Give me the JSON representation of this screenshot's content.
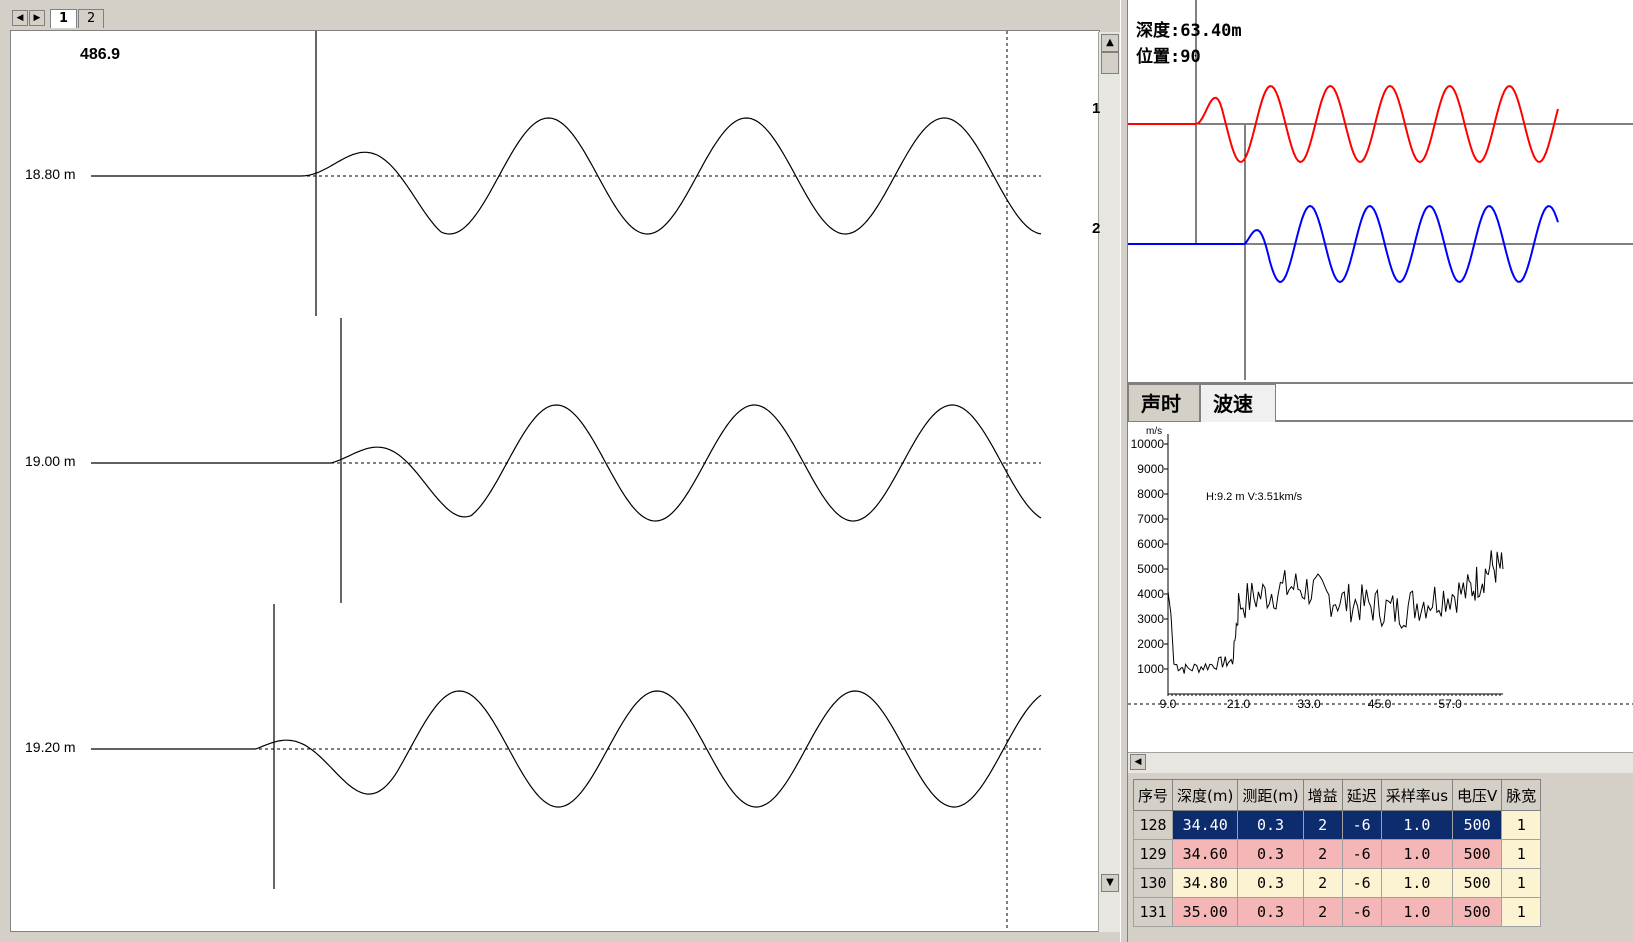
{
  "left": {
    "tabs": [
      "1",
      "2"
    ],
    "active_tab": "1",
    "top_value": "486.9",
    "traces": [
      {
        "depth_label": "18.80 m"
      },
      {
        "depth_label": "19.00 m"
      },
      {
        "depth_label": "19.20 m"
      }
    ]
  },
  "wave": {
    "depth": "深度:63.40m",
    "position": "位置:90",
    "channels": [
      {
        "label": "1",
        "color": "#ff0000"
      },
      {
        "label": "2",
        "color": "#0000ff"
      }
    ]
  },
  "velocity": {
    "tabs": [
      "声时",
      "波速"
    ],
    "active_tab": "波速",
    "unit": "m/s",
    "readout": "H:9.2 m V:3.51km/s"
  },
  "chart_data": {
    "type": "line",
    "ylim": [
      0,
      10000
    ],
    "y_ticks": [
      "10000",
      "9000",
      "8000",
      "7000",
      "6000",
      "5000",
      "4000",
      "3000",
      "2000",
      "1000"
    ],
    "x_ticks": [
      "9.0",
      "21.0",
      "33.0",
      "45.0",
      "57.0"
    ],
    "xlim": [
      9.0,
      66.0
    ],
    "series_color": "#000000",
    "trend": [
      {
        "x": 9.0,
        "y": 4100
      },
      {
        "x": 9.5,
        "y": 3200
      },
      {
        "x": 10.0,
        "y": 1200
      },
      {
        "x": 12.0,
        "y": 1000
      },
      {
        "x": 15.0,
        "y": 1100
      },
      {
        "x": 18.0,
        "y": 1250
      },
      {
        "x": 20.0,
        "y": 1300
      },
      {
        "x": 21.0,
        "y": 3600
      },
      {
        "x": 24.0,
        "y": 3900
      },
      {
        "x": 27.0,
        "y": 4100
      },
      {
        "x": 30.0,
        "y": 4300
      },
      {
        "x": 33.0,
        "y": 4200
      },
      {
        "x": 36.0,
        "y": 3900
      },
      {
        "x": 39.0,
        "y": 3700
      },
      {
        "x": 42.0,
        "y": 3600
      },
      {
        "x": 45.0,
        "y": 3500
      },
      {
        "x": 48.0,
        "y": 3300
      },
      {
        "x": 51.0,
        "y": 3600
      },
      {
        "x": 54.0,
        "y": 3800
      },
      {
        "x": 57.0,
        "y": 4000
      },
      {
        "x": 60.0,
        "y": 4100
      },
      {
        "x": 62.0,
        "y": 4600
      },
      {
        "x": 64.0,
        "y": 5100
      },
      {
        "x": 66.0,
        "y": 5000
      }
    ]
  },
  "table": {
    "headers": [
      "序号",
      "深度(m)",
      "测距(m)",
      "增益",
      "延迟",
      "采样率us",
      "电压V",
      "脉宽"
    ],
    "rows": [
      {
        "style": "sel",
        "cells": [
          "128",
          "34.40",
          "0.3",
          "2",
          "-6",
          "1.0",
          "500",
          "1"
        ]
      },
      {
        "style": "pink",
        "cells": [
          "129",
          "34.60",
          "0.3",
          "2",
          "-6",
          "1.0",
          "500",
          "1"
        ]
      },
      {
        "style": "cream",
        "cells": [
          "130",
          "34.80",
          "0.3",
          "2",
          "-6",
          "1.0",
          "500",
          "1"
        ]
      },
      {
        "style": "pink",
        "cells": [
          "131",
          "35.00",
          "0.3",
          "2",
          "-6",
          "1.0",
          "500",
          "1"
        ]
      }
    ]
  }
}
